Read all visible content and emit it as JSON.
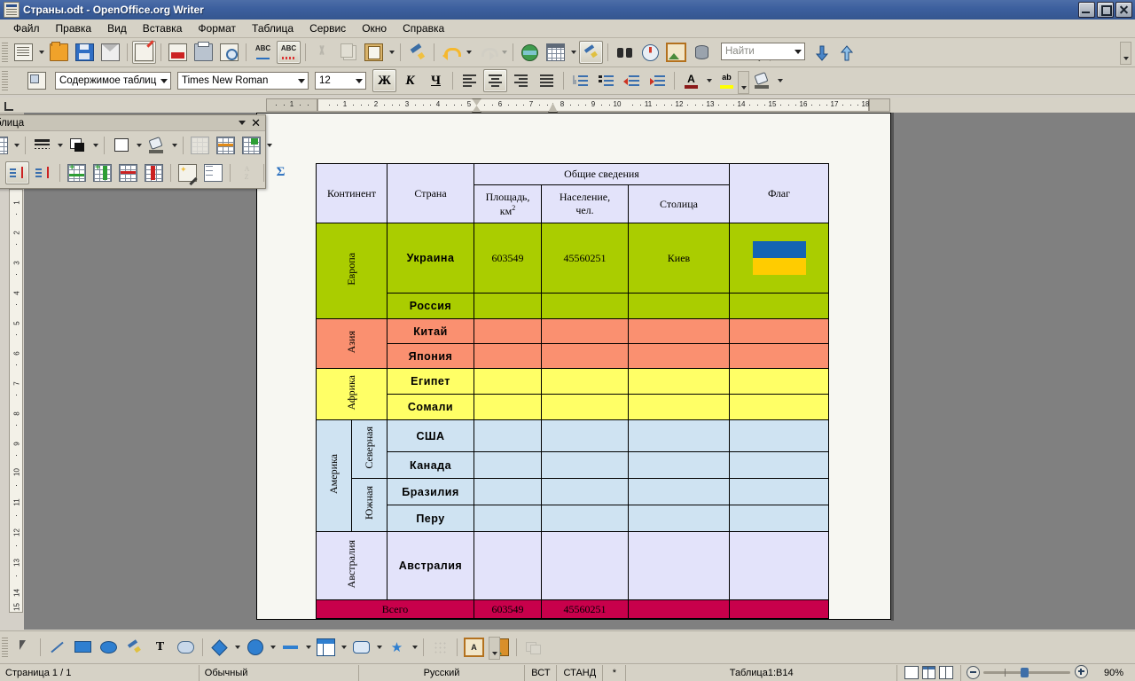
{
  "window": {
    "title": "Страны.odt - OpenOffice.org Writer",
    "app_icon": "writer-document-icon",
    "minimize": "minimize-icon",
    "restore": "restore-icon",
    "close": "close-icon"
  },
  "menubar": [
    {
      "label": "Файл"
    },
    {
      "label": "Правка"
    },
    {
      "label": "Вид"
    },
    {
      "label": "Вставка"
    },
    {
      "label": "Формат"
    },
    {
      "label": "Таблица"
    },
    {
      "label": "Сервис"
    },
    {
      "label": "Окно"
    },
    {
      "label": "Справка"
    }
  ],
  "standard_toolbar": {
    "find": {
      "placeholder": "Найти",
      "value": ""
    },
    "buttons": [
      {
        "name": "new-document",
        "icon": "new-doc-icon"
      },
      {
        "name": "open",
        "icon": "folder-open-icon"
      },
      {
        "name": "save",
        "icon": "floppy-save-icon"
      },
      {
        "name": "send-email",
        "icon": "mail-envelope-icon"
      },
      {
        "name": "edit-file",
        "icon": "edit-file-icon",
        "active": true
      },
      {
        "name": "export-pdf",
        "icon": "pdf-export-icon"
      },
      {
        "name": "print",
        "icon": "printer-icon"
      },
      {
        "name": "page-preview",
        "icon": "page-preview-icon"
      },
      {
        "name": "spelling",
        "icon": "abc-check-icon"
      },
      {
        "name": "autospellcheck",
        "icon": "abc-red-icon",
        "active": true
      },
      {
        "name": "cut",
        "icon": "scissors-icon",
        "disabled": true
      },
      {
        "name": "copy",
        "icon": "copy-icon",
        "disabled": true
      },
      {
        "name": "paste",
        "icon": "clipboard-paste-icon"
      },
      {
        "name": "clone-formatting",
        "icon": "paintbrush-icon"
      },
      {
        "name": "undo",
        "icon": "undo-arrow-icon"
      },
      {
        "name": "redo",
        "icon": "redo-arrow-icon",
        "disabled": true
      },
      {
        "name": "hyperlink",
        "icon": "globe-icon"
      },
      {
        "name": "insert-table",
        "icon": "table-grid-icon"
      },
      {
        "name": "show-draw-functions",
        "icon": "draw-functions-icon",
        "active": true
      },
      {
        "name": "find-replace",
        "icon": "binoculars-icon"
      },
      {
        "name": "navigator",
        "icon": "compass-icon"
      },
      {
        "name": "gallery",
        "icon": "picture-frame-icon"
      },
      {
        "name": "data-sources",
        "icon": "database-icon"
      },
      {
        "name": "formatting-marks",
        "icon": "pilcrow-icon"
      },
      {
        "name": "zoom",
        "icon": "magnifier-icon"
      },
      {
        "name": "help",
        "icon": "help-circle-icon"
      }
    ]
  },
  "format_toolbar": {
    "paragraph_style": "Содержимое таблицы",
    "font_name": "Times New Roman",
    "font_size": "12",
    "bold_label": "Ж",
    "italic_label": "К",
    "underline_label": "Ч",
    "buttons": [
      {
        "name": "styles-and-formatting",
        "icon": "styles-icon"
      },
      {
        "name": "align-left",
        "icon": "align-left-icon"
      },
      {
        "name": "align-center",
        "icon": "align-center-icon",
        "active": true
      },
      {
        "name": "align-right",
        "icon": "align-right-icon"
      },
      {
        "name": "justified",
        "icon": "align-justify-icon"
      },
      {
        "name": "numbering-on-off",
        "icon": "numbered-list-icon"
      },
      {
        "name": "bullets-on-off",
        "icon": "bulleted-list-icon"
      },
      {
        "name": "decrease-indent",
        "icon": "decrease-indent-icon"
      },
      {
        "name": "increase-indent",
        "icon": "increase-indent-icon"
      },
      {
        "name": "font-color",
        "icon": "font-color-icon",
        "letter": "A"
      },
      {
        "name": "highlighting",
        "icon": "highlighting-icon",
        "letter": "ab"
      },
      {
        "name": "background-color",
        "icon": "background-color-icon"
      }
    ]
  },
  "table_toolbar": {
    "title": "блица",
    "collapse": "chevron-down-icon",
    "close": "close-icon",
    "buttons": [
      {
        "name": "border-style",
        "icon": "line-style-icon"
      },
      {
        "name": "border-color",
        "icon": "border-color-icon"
      },
      {
        "name": "background-white",
        "icon": "white-square-icon"
      },
      {
        "name": "background-color",
        "icon": "bgcolor-pour-icon"
      },
      {
        "name": "merge-cells",
        "icon": "merge-cells-icon",
        "disabled": true
      },
      {
        "name": "split-cells",
        "icon": "split-cells-icon"
      },
      {
        "name": "optimize",
        "icon": "optimize-table-icon"
      },
      {
        "name": "top-align",
        "icon": "align-top-icon"
      },
      {
        "name": "center-vertical",
        "icon": "center-vertical-icon",
        "active": true
      },
      {
        "name": "bottom-align",
        "icon": "align-bottom-icon"
      },
      {
        "name": "insert-row",
        "icon": "insert-row-icon"
      },
      {
        "name": "insert-column",
        "icon": "insert-column-icon"
      },
      {
        "name": "delete-row",
        "icon": "delete-row-icon"
      },
      {
        "name": "delete-column",
        "icon": "delete-column-icon"
      },
      {
        "name": "autoformat",
        "icon": "autoformat-wand-icon"
      },
      {
        "name": "table-properties",
        "icon": "table-properties-icon"
      },
      {
        "name": "sort",
        "icon": "sort-az-icon",
        "disabled": true
      },
      {
        "name": "sum",
        "icon": "sigma-sum-icon"
      }
    ]
  },
  "rulers": {
    "horizontal_numbers": [
      "1",
      "1",
      "2",
      "3",
      "4",
      "5",
      "6",
      "7",
      "8",
      "9",
      "10",
      "11",
      "12",
      "13",
      "14",
      "15",
      "16",
      "17",
      "18"
    ],
    "vertical_numbers": [
      "1",
      "2",
      "3",
      "4",
      "5",
      "6",
      "7",
      "8",
      "9",
      "10",
      "11",
      "12",
      "13",
      "14",
      "15"
    ]
  },
  "table_data": {
    "headers": {
      "continent": "Континент",
      "country": "Страна",
      "general": "Общие сведения",
      "area": "Площадь,",
      "area_unit": "км",
      "area_unit_sup": "2",
      "population": "Население,",
      "population_unit": "чел.",
      "capital": "Столица",
      "flag": "Флаг"
    },
    "rows": [
      {
        "continent": "Европа",
        "subregion": "",
        "country": "Украина",
        "area": "603549",
        "population": "45560251",
        "capital": "Киев",
        "flag": "ukraine-flag",
        "color": "#aacd00"
      },
      {
        "continent": "",
        "subregion": "",
        "country": "Россия",
        "area": "",
        "population": "",
        "capital": "",
        "flag": "",
        "color": "#aacd00"
      },
      {
        "continent": "Азия",
        "subregion": "",
        "country": "Китай",
        "area": "",
        "population": "",
        "capital": "",
        "flag": "",
        "color": "#fa9070"
      },
      {
        "continent": "",
        "subregion": "",
        "country": "Япония",
        "area": "",
        "population": "",
        "capital": "",
        "flag": "",
        "color": "#fa9070"
      },
      {
        "continent": "Африка",
        "subregion": "",
        "country": "Египет",
        "area": "",
        "population": "",
        "capital": "",
        "flag": "",
        "color": "#ffff66"
      },
      {
        "continent": "",
        "subregion": "",
        "country": "Сомали",
        "area": "",
        "population": "",
        "capital": "",
        "flag": "",
        "color": "#ffff66"
      },
      {
        "continent": "Америка",
        "subregion": "Северная",
        "country": "США",
        "area": "",
        "population": "",
        "capital": "",
        "flag": "",
        "color": "#cfe3f2"
      },
      {
        "continent": "",
        "subregion": "",
        "country": "Канада",
        "area": "",
        "population": "",
        "capital": "",
        "flag": "",
        "color": "#cfe3f2"
      },
      {
        "continent": "",
        "subregion": "Южная",
        "country": "Бразилия",
        "area": "",
        "population": "",
        "capital": "",
        "flag": "",
        "color": "#cfe3f2"
      },
      {
        "continent": "",
        "subregion": "",
        "country": "Перу",
        "area": "",
        "population": "",
        "capital": "",
        "flag": "",
        "color": "#cfe3f2"
      },
      {
        "continent": "Австралия",
        "subregion": "",
        "country": "Австралия",
        "area": "",
        "population": "",
        "capital": "",
        "flag": "",
        "color": "#e3e3fa"
      }
    ],
    "total": {
      "label": "Всего",
      "area": "603549",
      "population": "45560251",
      "capital": "",
      "flag": "",
      "color": "#c8004b"
    },
    "flag_colors": {
      "top": "#1464b4",
      "bottom": "#ffcc00"
    },
    "header_color": "#e3e3fa"
  },
  "drawing_toolbar": [
    {
      "name": "select",
      "icon": "arrow-cursor-icon"
    },
    {
      "name": "line",
      "icon": "line-icon"
    },
    {
      "name": "rectangle",
      "icon": "rectangle-icon"
    },
    {
      "name": "ellipse",
      "icon": "ellipse-icon"
    },
    {
      "name": "freeform-line",
      "icon": "freeform-pencil-icon"
    },
    {
      "name": "text",
      "icon": "text-T-icon"
    },
    {
      "name": "callouts",
      "icon": "callout-icon"
    },
    {
      "name": "basic-shapes",
      "icon": "diamond-shape-icon"
    },
    {
      "name": "symbol-shapes",
      "icon": "smiley-icon"
    },
    {
      "name": "block-arrows",
      "icon": "block-arrow-icon"
    },
    {
      "name": "flowchart",
      "icon": "flowchart-icon"
    },
    {
      "name": "callout-shapes",
      "icon": "speech-balloon-icon"
    },
    {
      "name": "stars",
      "icon": "star-icon"
    },
    {
      "name": "points",
      "icon": "edit-points-icon",
      "disabled": true
    },
    {
      "name": "fontwork",
      "icon": "fontwork-A-icon"
    },
    {
      "name": "from-file",
      "icon": "image-from-file-icon"
    },
    {
      "name": "extrusion",
      "icon": "extrusion-icon",
      "disabled": true
    }
  ],
  "statusbar": {
    "page": "Страница  1 / 1",
    "page_style": "Обычный",
    "language": "Русский",
    "insert_mode": "ВСТ",
    "selection_mode": "СТАНД",
    "modified": "*",
    "table_cell": "Таблица1:B14",
    "view_layout": [
      "single-page-icon",
      "multi-page-icon",
      "book-view-icon"
    ],
    "zoom": "90%",
    "zoom_out": "zoom-out-icon",
    "zoom_in": "zoom-in-icon"
  }
}
